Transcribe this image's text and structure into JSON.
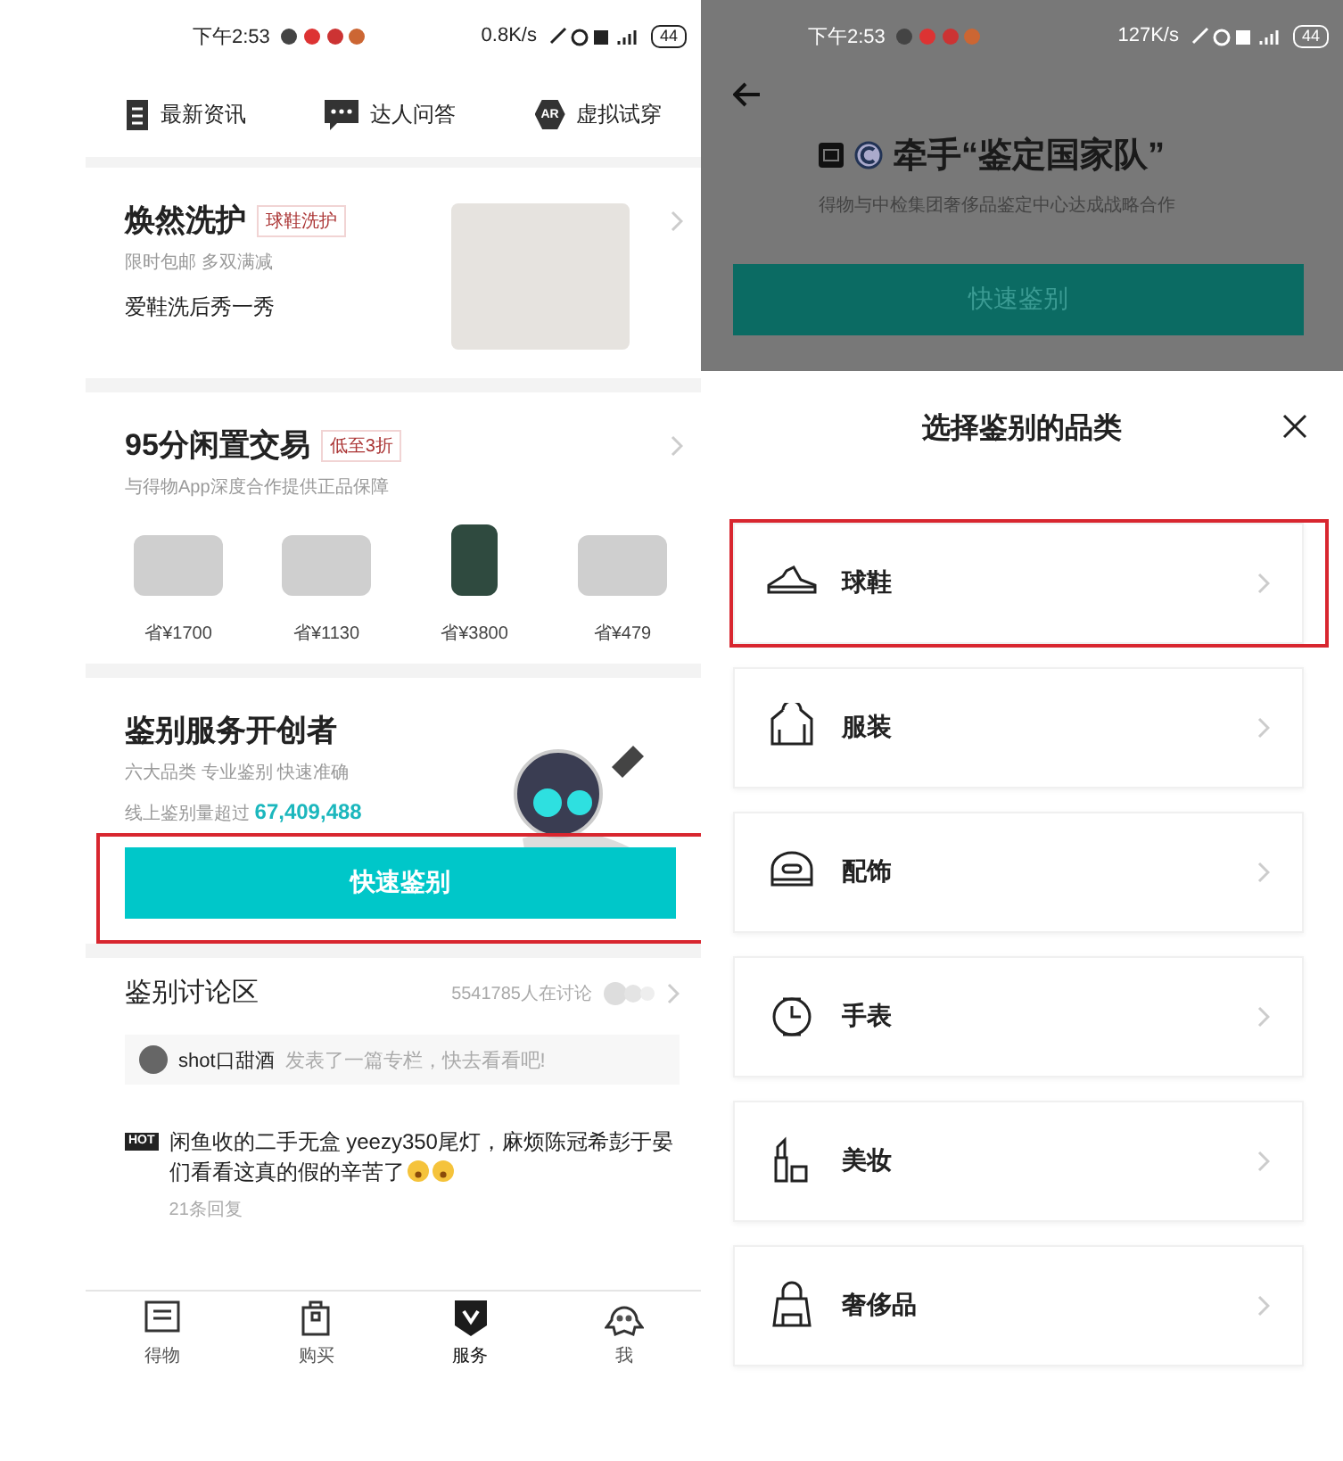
{
  "left_screen": {
    "status_bar": {
      "time": "下午2:53",
      "speed": "0.8K/s",
      "battery": "44"
    },
    "quick_links": [
      {
        "kind": "news",
        "label": "最新资讯"
      },
      {
        "kind": "chat",
        "label": "达人问答"
      },
      {
        "kind": "ar",
        "icon_text": "AR",
        "label": "虚拟试穿"
      }
    ],
    "care_card": {
      "title": "焕然洗护",
      "tag": "球鞋洗护",
      "subtitle": "限时包邮 多双满减",
      "line": "爱鞋洗后秀一秀"
    },
    "resale_card": {
      "title": "95分闲置交易",
      "tag": "低至3折",
      "subtitle": "与得物App深度合作提供正品保障",
      "products": [
        {
          "kind": "sneaker",
          "price": "省¥1700"
        },
        {
          "kind": "sneaker",
          "price": "省¥1130"
        },
        {
          "kind": "phone",
          "price": "省¥3800"
        },
        {
          "kind": "sneaker",
          "price": "省¥479"
        }
      ]
    },
    "service_card": {
      "title": "鉴别服务开创者",
      "subtitle": "六大品类 专业鉴别 快速准确",
      "stat_label": "线上鉴别量超过",
      "stat_value": "67,409,488",
      "button": {
        "label": "快速鉴别",
        "highlighted": true
      }
    },
    "discussion": {
      "title": "鉴别讨论区",
      "count": "5541785人在讨论",
      "notice": {
        "user": "shot口甜酒",
        "text": "发表了一篇专栏，快去看看吧!"
      },
      "posts": [
        {
          "badge": "HOT",
          "text": "闲鱼收的二手无盒 yeezy350尾灯，麻烦陈冠希彭于晏们看看这真的假的辛苦了",
          "emojis": [
            {
              "kind": "astonished"
            },
            {
              "kind": "astonished"
            }
          ],
          "replies": "21条回复"
        }
      ]
    },
    "bottom_nav": [
      {
        "kind": "home",
        "label": "得物",
        "selected": false
      },
      {
        "kind": "bag",
        "label": "购买",
        "selected": false
      },
      {
        "kind": "shield",
        "label": "服务",
        "selected": true
      },
      {
        "kind": "ghost",
        "label": "我",
        "selected": false
      }
    ]
  },
  "right_screen": {
    "status_bar": {
      "time": "下午2:53",
      "speed": "127K/s",
      "battery": "44"
    },
    "banner": {
      "title": "牵手“鉴定国家队”",
      "subtitle": "得物与中检集团奢侈品鉴定中心达成战略合作",
      "button": "快速鉴别"
    },
    "sheet": {
      "title": "选择鉴别的品类",
      "categories": [
        {
          "kind": "sneaker",
          "label": "球鞋",
          "highlighted": true
        },
        {
          "kind": "hoodie",
          "label": "服装",
          "highlighted": false
        },
        {
          "kind": "cap",
          "label": "配饰",
          "highlighted": false
        },
        {
          "kind": "watch",
          "label": "手表",
          "highlighted": false
        },
        {
          "kind": "lipstick",
          "label": "美妆",
          "highlighted": false
        },
        {
          "kind": "handbag",
          "label": "奢侈品",
          "highlighted": false
        }
      ]
    }
  }
}
